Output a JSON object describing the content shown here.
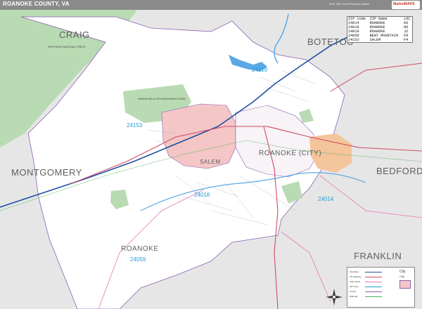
{
  "header": {
    "title": "ROANOKE COUNTY, VA",
    "edition": "2021 ZIP Code Premium Edition",
    "logo": "MarketMAPS"
  },
  "colors": {
    "background": "#ffffff",
    "neighbor_gray": "#e6e6e6",
    "forest_green": "#b9dbb3",
    "salem_pink": "#f4c6c6",
    "roanoke_city_orange": "#f4c49b",
    "water_blue": "#5aa9e6",
    "zip_label_blue": "#2a9bd0",
    "interstate_blue": "#1f4fa3",
    "us_highway_red": "#d14a62",
    "state_road_pink": "#e27ab8",
    "boundary_purple": "#8c5fb2",
    "rail_green": "#4caf50"
  },
  "counties": [
    {
      "name": "CRAIG"
    },
    {
      "name": "BOTETOURT",
      "display": "BOTETOU"
    },
    {
      "name": "MONTGOMERY"
    },
    {
      "name": "BEDFORD"
    },
    {
      "name": "FRANKLIN"
    },
    {
      "name": "ROANOKE"
    },
    {
      "name": "ROANOKE (CITY)"
    },
    {
      "name": "SALEM"
    }
  ],
  "zip_labels": [
    "24019",
    "24153",
    "24018",
    "24014",
    "24059"
  ],
  "small_labels": {
    "jefferson_forest": "JEFFERSON NATIONAL FOREST",
    "havens_wma": "HAVENS WILDLIFE MANAGEMENT AREA"
  },
  "zip_table": {
    "headers": [
      "ZIP Code",
      "ZIP Name",
      "LOC"
    ],
    "rows": [
      [
        "24014",
        "ROANOKE",
        "K6"
      ],
      [
        "24018",
        "ROANOKE",
        "H6"
      ],
      [
        "24019",
        "ROANOKE",
        "J2"
      ],
      [
        "24059",
        "BENT MOUNTAIN",
        "F8"
      ],
      [
        "24153",
        "SALEM",
        "F4"
      ]
    ]
  },
  "legend": {
    "items": [
      {
        "label": "Interstate",
        "color": "#1f4fa3"
      },
      {
        "label": "US Highway",
        "color": "#d14a62"
      },
      {
        "label": "State Road",
        "color": "#e27ab8"
      },
      {
        "label": "ZIP Code",
        "color": "#2a9bd0"
      },
      {
        "label": "County",
        "color": "#8c5fb2"
      },
      {
        "label": "Railroad",
        "color": "#4caf50"
      }
    ],
    "city_label": "City",
    "city_sub": "City"
  },
  "compass": {
    "n": "N",
    "s": "S",
    "e": "E",
    "w": "W"
  }
}
